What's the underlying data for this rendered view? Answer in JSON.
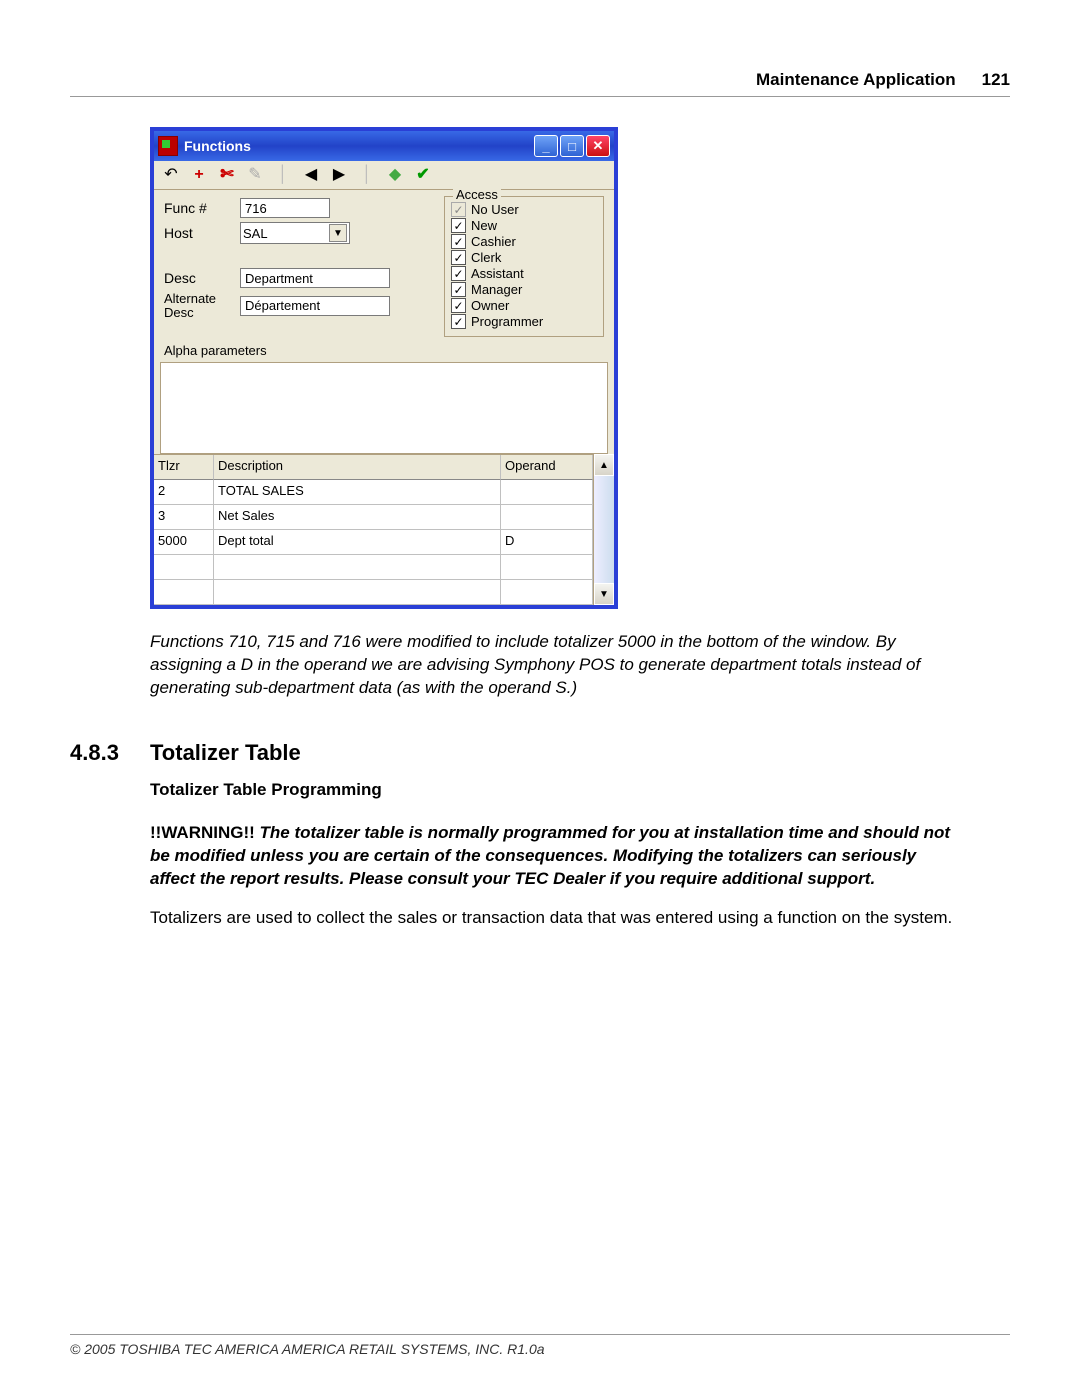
{
  "header": {
    "title": "Maintenance Application",
    "page": "121"
  },
  "window": {
    "title": "Functions",
    "toolbar_icons": [
      "undo",
      "add",
      "cut",
      "copy",
      "sep",
      "prev",
      "next",
      "sep",
      "paint",
      "check"
    ],
    "form": {
      "func_label": "Func #",
      "func_value": "716",
      "host_label": "Host",
      "host_value": "SAL",
      "desc_label": "Desc",
      "desc_value": "Department",
      "alt_label": "Alternate\nDesc",
      "alt_label_line1": "Alternate",
      "alt_label_line2": "Desc",
      "alt_value": "Département",
      "alpha_label": "Alpha parameters"
    },
    "access": {
      "legend": "Access",
      "items": [
        {
          "label": "No User",
          "checked": false
        },
        {
          "label": "New",
          "checked": true
        },
        {
          "label": "Cashier",
          "checked": true
        },
        {
          "label": "Clerk",
          "checked": true
        },
        {
          "label": "Assistant",
          "checked": true
        },
        {
          "label": "Manager",
          "checked": true
        },
        {
          "label": "Owner",
          "checked": true
        },
        {
          "label": "Programmer",
          "checked": true
        }
      ]
    },
    "grid": {
      "headers": {
        "c1": "Tlzr",
        "c2": "Description",
        "c3": "Operand"
      },
      "rows": [
        {
          "c1": "2",
          "c2": "TOTAL SALES",
          "c3": ""
        },
        {
          "c1": "3",
          "c2": "Net Sales",
          "c3": ""
        },
        {
          "c1": "5000",
          "c2": "Dept total",
          "c3": "D"
        },
        {
          "c1": "",
          "c2": "",
          "c3": ""
        },
        {
          "c1": "",
          "c2": "",
          "c3": ""
        }
      ]
    }
  },
  "caption": "Functions 710, 715 and 716 were modified to include  totalizer 5000 in the bottom of the window. By assigning a D in the operand we are advising Symphony POS to generate department totals instead of generating sub-department data (as with the operand S.)",
  "section": {
    "num": "4.8.3",
    "title": "Totalizer Table"
  },
  "subhead": "Totalizer Table Programming",
  "warning_label": "!!WARNING!! ",
  "warning_body": "The totalizer table is normally programmed for you at installation time and should not be modified unless you are certain of the consequences. Modifying the totalizers can seriously affect the report results. Please consult your TEC Dealer if you require additional support.",
  "body1": " Totalizers are used to collect the sales or transaction data that was entered using a function on the system.",
  "footer": "© 2005 TOSHIBA TEC AMERICA AMERICA RETAIL SYSTEMS, INC.   R1.0a"
}
